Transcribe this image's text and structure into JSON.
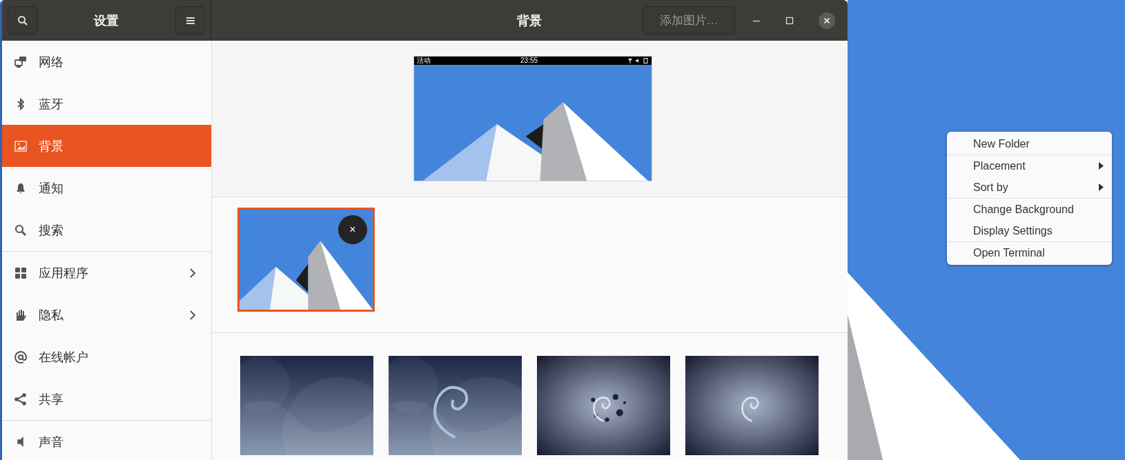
{
  "window": {
    "sidebar_title": "设置",
    "title": "背景",
    "add_button": "添加图片…"
  },
  "sidebar": {
    "items": [
      {
        "label": "网络",
        "selected": false,
        "has_submenu": false,
        "divider_before": false
      },
      {
        "label": "蓝牙",
        "selected": false,
        "has_submenu": false,
        "divider_before": false
      },
      {
        "label": "背景",
        "selected": true,
        "has_submenu": false,
        "divider_before": false
      },
      {
        "label": "通知",
        "selected": false,
        "has_submenu": false,
        "divider_before": false
      },
      {
        "label": "搜索",
        "selected": false,
        "has_submenu": false,
        "divider_before": false
      },
      {
        "label": "应用程序",
        "selected": false,
        "has_submenu": true,
        "divider_before": true
      },
      {
        "label": "隐私",
        "selected": false,
        "has_submenu": true,
        "divider_before": false
      },
      {
        "label": "在线帐户",
        "selected": false,
        "has_submenu": false,
        "divider_before": false
      },
      {
        "label": "共享",
        "selected": false,
        "has_submenu": false,
        "divider_before": false
      },
      {
        "label": "声音",
        "selected": false,
        "has_submenu": false,
        "divider_before": true
      }
    ]
  },
  "preview": {
    "activities": "活动",
    "clock": "23:55"
  },
  "custom_wallpapers": [
    {
      "kind": "mountains",
      "selected": true,
      "remove_label": "×"
    }
  ],
  "wallpapers": [
    {
      "kind": "waves"
    },
    {
      "kind": "swirl"
    },
    {
      "kind": "splash"
    },
    {
      "kind": "glow"
    }
  ],
  "context_menu": {
    "sections": [
      [
        {
          "label": "New Folder",
          "has_submenu": false
        }
      ],
      [
        {
          "label": "Placement",
          "has_submenu": true
        },
        {
          "label": "Sort by",
          "has_submenu": true
        }
      ],
      [
        {
          "label": "Change Background",
          "has_submenu": false
        },
        {
          "label": "Display Settings",
          "has_submenu": false
        }
      ],
      [
        {
          "label": "Open Terminal",
          "has_submenu": false
        }
      ]
    ]
  }
}
